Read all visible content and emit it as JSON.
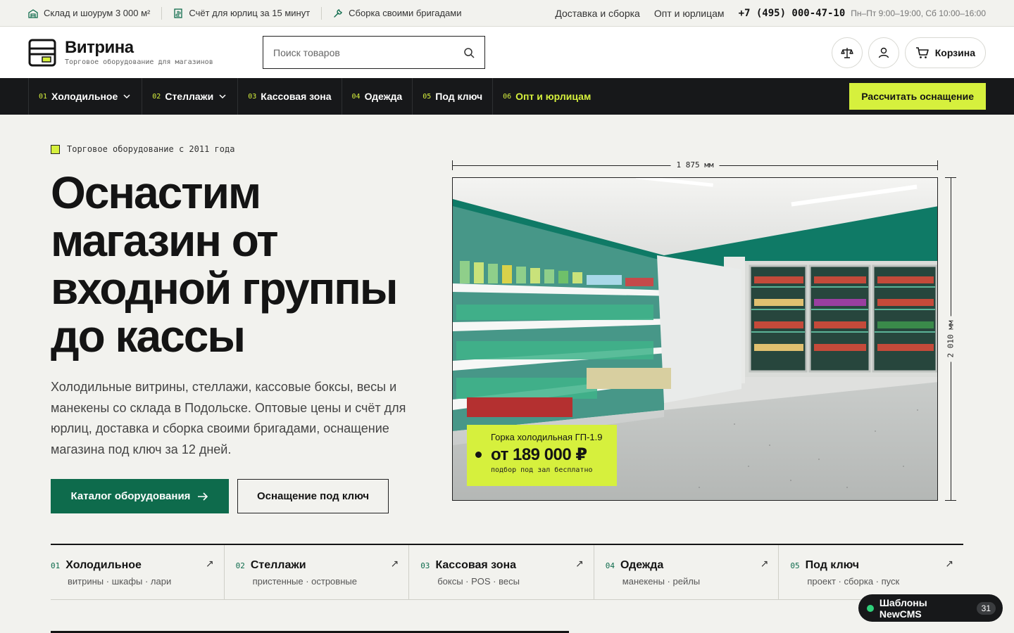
{
  "topbar": {
    "items": [
      {
        "icon": "warehouse-icon",
        "label": "Склад и шоурум 3 000 м²"
      },
      {
        "icon": "invoice-icon",
        "label": "Счёт для юрлиц за 15 минут"
      },
      {
        "icon": "wrench-icon",
        "label": "Сборка своими бригадами"
      }
    ],
    "links": [
      "Доставка и сборка",
      "Опт и юрлицам"
    ],
    "phone": "+7 (495) 000-47-10",
    "hours": "Пн–Пт 9:00–19:00, Сб 10:00–16:00"
  },
  "header": {
    "logo_title": "Витрина",
    "logo_subtitle": "Торговое оборудование для магазинов",
    "search_placeholder": "Поиск товаров",
    "cart_label": "Корзина"
  },
  "nav": {
    "items": [
      {
        "num": "01",
        "label": "Холодильное",
        "has_dropdown": true
      },
      {
        "num": "02",
        "label": "Стеллажи",
        "has_dropdown": true
      },
      {
        "num": "03",
        "label": "Кассовая зона",
        "has_dropdown": false
      },
      {
        "num": "04",
        "label": "Одежда",
        "has_dropdown": false
      },
      {
        "num": "05",
        "label": "Под ключ",
        "has_dropdown": false
      },
      {
        "num": "06",
        "label": "Опт и юрлицам",
        "has_dropdown": false
      }
    ],
    "cta": "Рассчитать оснащение"
  },
  "hero": {
    "eyebrow": "Торговое оборудование с 2011 года",
    "title_lines": [
      "Оснастим",
      "магазин от",
      "входной группы",
      "до кассы"
    ],
    "description": "Холодильные витрины, стеллажи, кассовые боксы, весы и манекены со склада в Подольске. Оптовые цены и счёт для юрлиц, доставка и сборка своими бригадами, оснащение магазина под ключ за 12 дней.",
    "primary_button": "Каталог оборудования",
    "secondary_button": "Оснащение под ключ",
    "dim_width": "1 875 мм",
    "dim_height": "2 010 мм",
    "product": {
      "name": "Горка холодильная ГП-1.9",
      "price": "от 189 000 ₽",
      "note": "подбор под зал бесплатно"
    }
  },
  "categories": [
    {
      "num": "01",
      "title": "Холодильное",
      "subtitle": "витрины · шкафы · лари"
    },
    {
      "num": "02",
      "title": "Стеллажи",
      "subtitle": "пристенные · островные"
    },
    {
      "num": "03",
      "title": "Кассовая зона",
      "subtitle": "боксы · POS · весы"
    },
    {
      "num": "04",
      "title": "Одежда",
      "subtitle": "манекены · рейлы"
    },
    {
      "num": "05",
      "title": "Под ключ",
      "subtitle": "проект · сборка · пуск"
    }
  ],
  "badge": {
    "label": "Шаблоны NewCMS",
    "count": "31"
  },
  "colors": {
    "accent": "#d6f03d",
    "brand_green": "#0e6b4c",
    "dark": "#17181a",
    "background": "#f2f2ee"
  }
}
